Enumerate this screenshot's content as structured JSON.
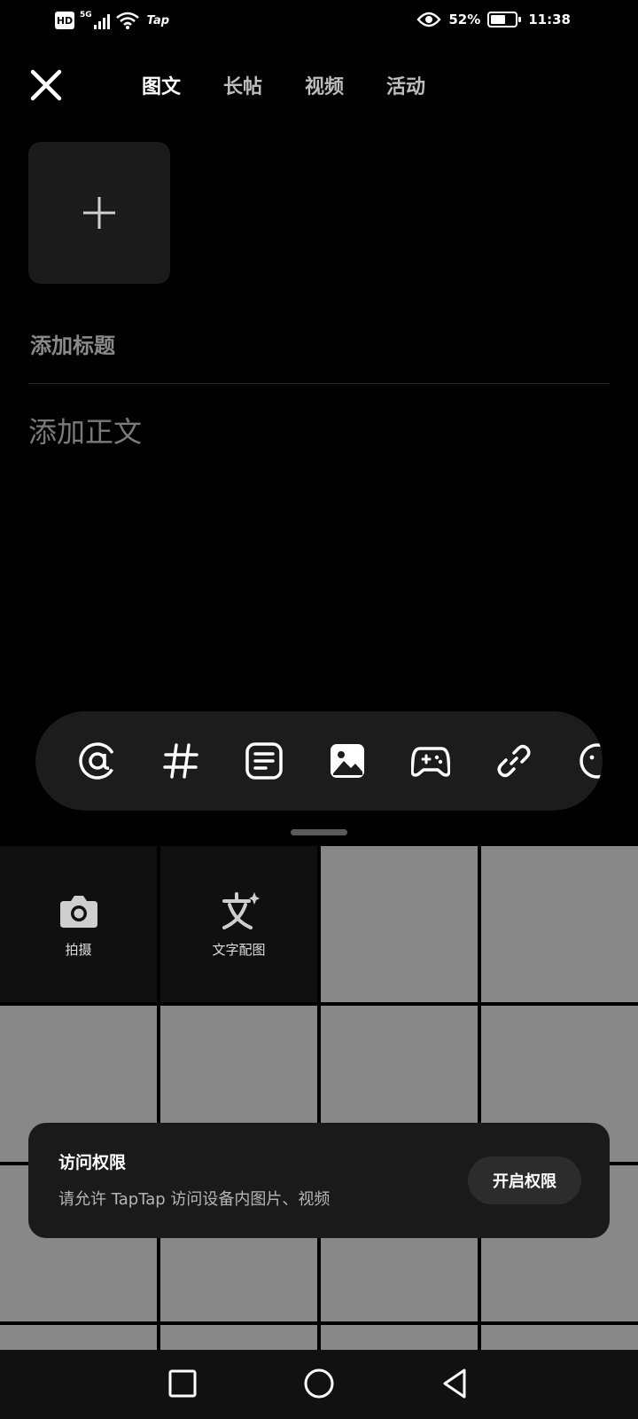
{
  "status_bar": {
    "hd": "HD",
    "network": "5G",
    "carrier_badge": "Tap",
    "battery_percent": "52%",
    "battery_level": 0.52,
    "time": "11:38"
  },
  "header": {
    "close_icon": "close-icon",
    "tabs": [
      {
        "label": "图文",
        "active": true
      },
      {
        "label": "长帖",
        "active": false
      },
      {
        "label": "视频",
        "active": false
      },
      {
        "label": "活动",
        "active": false
      }
    ],
    "accent_color": "#15c5ce"
  },
  "editor": {
    "add_media_icon": "plus-icon",
    "title_placeholder": "添加标题",
    "body_placeholder": "添加正文"
  },
  "toolbar": {
    "icons": [
      "at-mention-icon",
      "hashtag-icon",
      "text-format-icon",
      "image-icon",
      "gamepad-icon",
      "link-icon",
      "emoji-icon"
    ]
  },
  "media_grid": {
    "camera_label": "拍摄",
    "text_image_label": "文字配图"
  },
  "permission_card": {
    "title": "访问权限",
    "description": "请允许 TapTap 访问设备内图片、视频",
    "button_label": "开启权限"
  },
  "navbar": {
    "icons": [
      "recents-square-icon",
      "home-circle-icon",
      "back-triangle-icon"
    ]
  }
}
